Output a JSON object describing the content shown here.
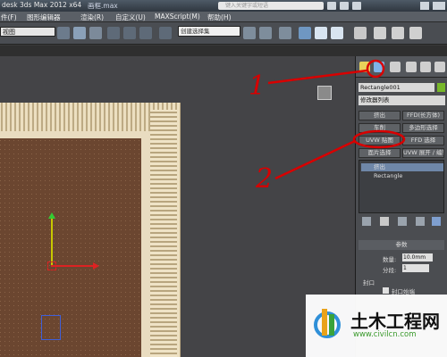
{
  "window": {
    "title": "desk 3ds Max  2012 x64",
    "filename": "画框.max",
    "search_placeholder": "键入关键字或短语"
  },
  "menu": [
    "件(F)",
    "图形编辑器",
    "渲染(R)",
    "自定义(U)",
    "MAXScript(M)",
    "帮助(H)"
  ],
  "toolbar": {
    "view_selector": "视图",
    "selection_set": "创建选择集"
  },
  "command_panel": {
    "object_name": "Rectangle001",
    "object_color": "#78b82a",
    "modifier_list": "修改器列表",
    "modifier_buttons": [
      [
        "挤出",
        "FFD(长方体)"
      ],
      [
        "车削",
        "多边形选择"
      ],
      [
        "UVW 贴图",
        "FFD 选择"
      ],
      [
        "面片选择",
        "UVW 展开 / 编辑法线"
      ]
    ],
    "stack": [
      "挤出",
      "Rectangle"
    ],
    "parameters": {
      "header": "参数",
      "amount_label": "数量:",
      "amount_value": "10.0mm",
      "segments_label": "分段:",
      "segments_value": "1",
      "capping_label": "封口",
      "cap_start_label": "封口始端"
    }
  },
  "annotations": {
    "label1": "1",
    "label2": "2",
    "color": "#d80000"
  },
  "watermark": {
    "title": "土木工程网",
    "url": "www.civilcn.com"
  },
  "icons": [
    "modify-tab-icon",
    "create-tab-icon",
    "hierarchy-tab-icon",
    "motion-tab-icon",
    "display-tab-icon",
    "utilities-tab-icon"
  ]
}
